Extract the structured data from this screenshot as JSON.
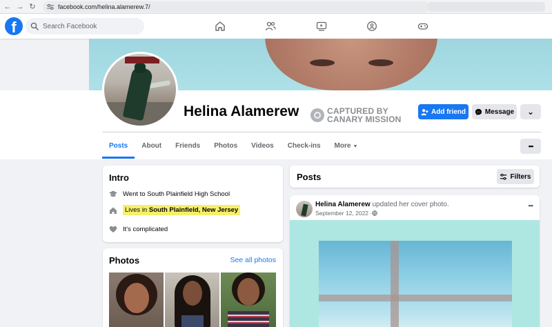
{
  "browser": {
    "url": "facebook.com/helina.alamerew.7/",
    "back_icon": "←",
    "forward_icon": "→",
    "reload_icon": "↻"
  },
  "nav": {
    "logo": "f",
    "search_placeholder": "Search Facebook",
    "icons": [
      "home-icon",
      "friends-icon",
      "watch-icon",
      "groups-icon",
      "gaming-icon"
    ]
  },
  "profile": {
    "name": "Helina Alamerew",
    "watermark_line1": "CAPTURED BY",
    "watermark_line2": "CANARY MISSION",
    "add_friend_label": "Add friend",
    "message_label": "Message",
    "more_dropdown_icon": "⌄"
  },
  "tabs": {
    "items": [
      "Posts",
      "About",
      "Friends",
      "Photos",
      "Videos",
      "Check-ins",
      "More"
    ],
    "active": "Posts",
    "more_caret": "▼",
    "overflow_label": "•••"
  },
  "intro": {
    "title": "Intro",
    "education": "Went to South Plainfield High School",
    "lives_prefix": "Lives in ",
    "lives_place": "South Plainfield, New Jersey",
    "relationship": "It's complicated"
  },
  "photos": {
    "title": "Photos",
    "see_all_label": "See all photos"
  },
  "posts": {
    "title": "Posts",
    "filters_label": "Filters",
    "post": {
      "author": "Helina Alamerew",
      "action": " updated her cover photo.",
      "date": "September 12, 2022 · ",
      "options_label": "•••"
    }
  },
  "colors": {
    "brand": "#1877f2",
    "highlight": "#f5f06a",
    "background": "#f0f2f5"
  }
}
